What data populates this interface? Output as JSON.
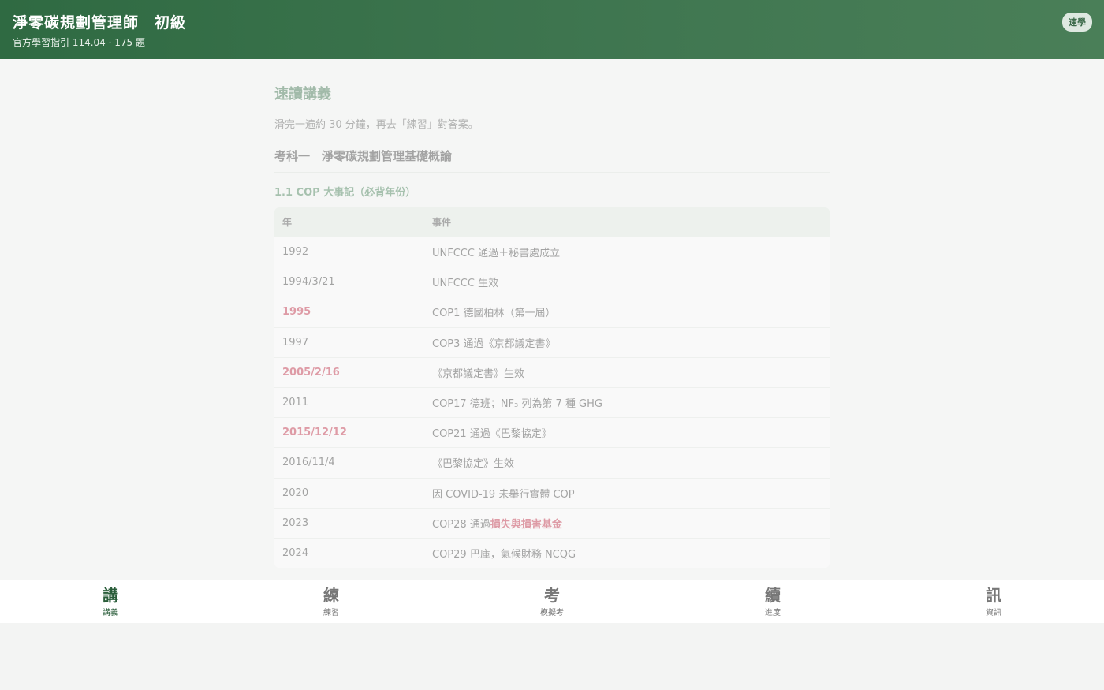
{
  "header": {
    "title": "淨零碳規劃管理師　初級",
    "subtitle": "官方學習指引 114.04 · 175 題",
    "badge": "速學"
  },
  "lesson": {
    "title": "速讀講義",
    "description": "滑完一遍約 30 分鐘，再去「練習」對答案。",
    "subject_heading": "考科一　淨零碳規劃管理基礎概論",
    "section_heading": "1.1 COP 大事記（必背年份）",
    "table": {
      "headers": [
        "年",
        "事件"
      ],
      "rows": [
        {
          "year": "1992",
          "event": "UNFCCC 通過＋秘書處成立",
          "year_highlight": false
        },
        {
          "year": "1994/3/21",
          "event": "UNFCCC 生效",
          "year_highlight": false
        },
        {
          "year": "1995",
          "event": "COP1 德國柏林（第一屆）",
          "year_highlight": true
        },
        {
          "year": "1997",
          "event": "COP3 通過《京都議定書》",
          "year_highlight": false
        },
        {
          "year": "2005/2/16",
          "event": "《京都議定書》生效",
          "year_highlight": true
        },
        {
          "year": "2011",
          "event": "COP17 德班；NF₃ 列為第 7 種 GHG",
          "year_highlight": false
        },
        {
          "year": "2015/12/12",
          "event": "COP21 通過《巴黎協定》",
          "year_highlight": true
        },
        {
          "year": "2016/11/4",
          "event": "《巴黎協定》生效",
          "year_highlight": false
        },
        {
          "year": "2020",
          "event": "因 COVID-19 未舉行實體 COP",
          "year_highlight": false
        },
        {
          "year": "2023",
          "event": "COP28 通過",
          "event_highlight": "損失與損害基金",
          "year_highlight": false
        },
        {
          "year": "2024",
          "event": "COP29 巴庫，氣候財務 NCQG",
          "year_highlight": false
        }
      ]
    }
  },
  "nav": {
    "items": [
      {
        "glyph": "講",
        "label": "講義"
      },
      {
        "glyph": "練",
        "label": "練習"
      },
      {
        "glyph": "考",
        "label": "模擬考"
      },
      {
        "glyph": "續",
        "label": "進度"
      },
      {
        "glyph": "訊",
        "label": "資訊"
      }
    ]
  },
  "colors": {
    "header": "#2f6a42",
    "accent": "#2a5d3a",
    "highlight": "#c0203a"
  }
}
